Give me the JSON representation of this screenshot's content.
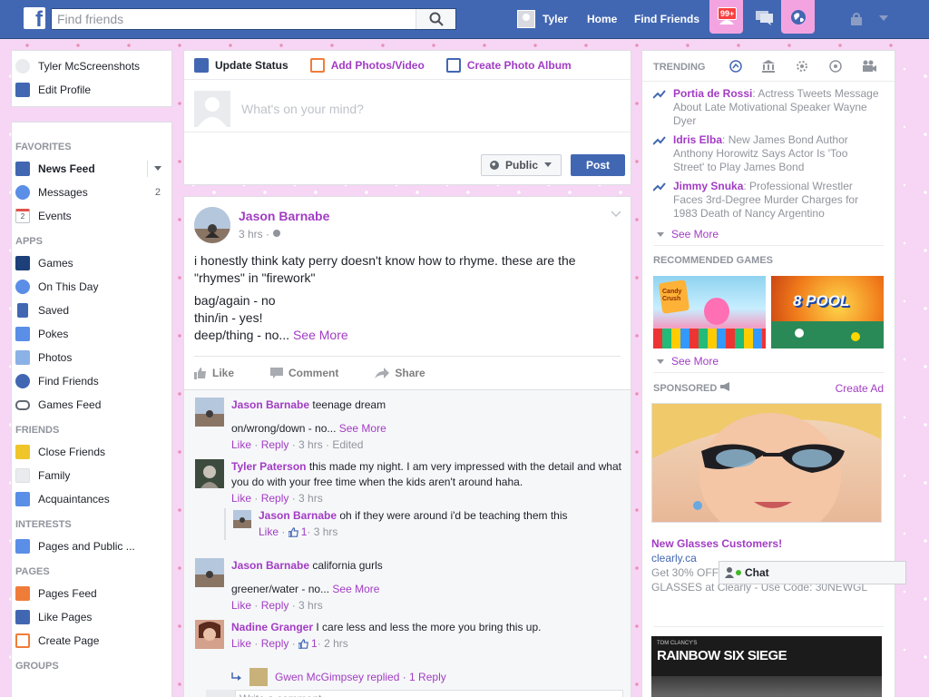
{
  "topbar": {
    "logo": "f",
    "search_placeholder": "Find friends",
    "user_name": "Tyler",
    "home": "Home",
    "find_friends": "Find Friends",
    "notif_badge": "99+"
  },
  "left": {
    "profile_name": "Tyler McScreenshots",
    "edit_profile": "Edit Profile",
    "sections": [
      {
        "title": "FAVORITES",
        "items": [
          "News Feed",
          "Messages",
          "Events"
        ],
        "counts": [
          "",
          "2",
          ""
        ]
      },
      {
        "title": "APPS",
        "items": [
          "Games",
          "On This Day",
          "Saved",
          "Pokes",
          "Photos",
          "Find Friends",
          "Games Feed"
        ]
      },
      {
        "title": "FRIENDS",
        "items": [
          "Close Friends",
          "Family",
          "Acquaintances"
        ]
      },
      {
        "title": "INTERESTS",
        "items": [
          "Pages and Public ..."
        ]
      },
      {
        "title": "PAGES",
        "items": [
          "Pages Feed",
          "Like Pages",
          "Create Page"
        ]
      },
      {
        "title": "GROUPS",
        "items": []
      }
    ],
    "event_icon_text": "2"
  },
  "composer": {
    "tab_status": "Update Status",
    "tab_photos": "Add Photos/Video",
    "tab_album": "Create Photo Album",
    "placeholder": "What's on your mind?",
    "privacy": "Public",
    "post": "Post"
  },
  "post": {
    "author": "Jason Barnabe",
    "time": "3 hrs · ",
    "line1": "i honestly think katy perry doesn't know how to rhyme. these are the \"rhymes\" in \"firework\"",
    "line2": "bag/again - no",
    "line3": "thin/in - yes!",
    "line4": "deep/thing - no... ",
    "see_more": "See More",
    "like": "Like",
    "comment": "Comment",
    "share": "Share"
  },
  "comments": [
    {
      "name": "Jason Barnabe",
      "text": " teenage dream",
      "text2": "on/wrong/down - no... ",
      "see_more": "See More",
      "like": "Like",
      "reply": "Reply",
      "meta": " · 3 hrs · Edited"
    },
    {
      "name": "Tyler Paterson",
      "text": " this made my night. I am very impressed with the detail and what you do with your free time when the kids aren't around haha.",
      "like": "Like",
      "reply": "Reply",
      "meta": " · 3 hrs"
    },
    {
      "name": "Jason Barnabe",
      "text": " oh if they were around i'd be teaching them this",
      "like": "Like",
      "likes": "1",
      "meta": " · 3 hrs"
    },
    {
      "name": "Jason Barnabe",
      "text": " california gurls",
      "text2": "greener/water - no... ",
      "see_more": "See More",
      "like": "Like",
      "reply": "Reply",
      "meta": " · 3 hrs"
    },
    {
      "name": "Nadine Granger",
      "text": " I care less and less the more you bring this up.",
      "like": "Like",
      "reply": "Reply",
      "likes": "1",
      "meta": " · 2 hrs"
    }
  ],
  "reply_summary": "Gwen McGimpsey replied · 1 Reply",
  "write_comment": "Write a comment...",
  "right": {
    "trending": "TRENDING",
    "trends": [
      {
        "name": "Portia de Rossi",
        "text": ": Actress Tweets Message About Late Motivational Speaker Wayne Dyer"
      },
      {
        "name": "Idris Elba",
        "text": ": New James Bond Author Anthony Horowitz Says Actor Is 'Too Street' to Play James Bond"
      },
      {
        "name": "Jimmy Snuka",
        "text": ": Professional Wrestler Faces 3rd-Degree Murder Charges for 1983 Death of Nancy Argentino"
      }
    ],
    "see_more": "See More",
    "recommended_games": "RECOMMENDED GAMES",
    "game1": "Candy Crush",
    "game2": "8 POOL",
    "sponsored": "SPONSORED",
    "create_ad": "Create Ad",
    "ad_title": "New Glasses Customers!",
    "ad_domain": "clearly.ca",
    "ad_text": "Get 30% OFF your first pair of PRESCRIPTION GLASSES at Clearly - Use Code: 30NEWGL",
    "ad2_title": "RAINBOW SIX SIEGE",
    "ad2_brand": "TOM CLANCY'S"
  },
  "chat": "Chat"
}
